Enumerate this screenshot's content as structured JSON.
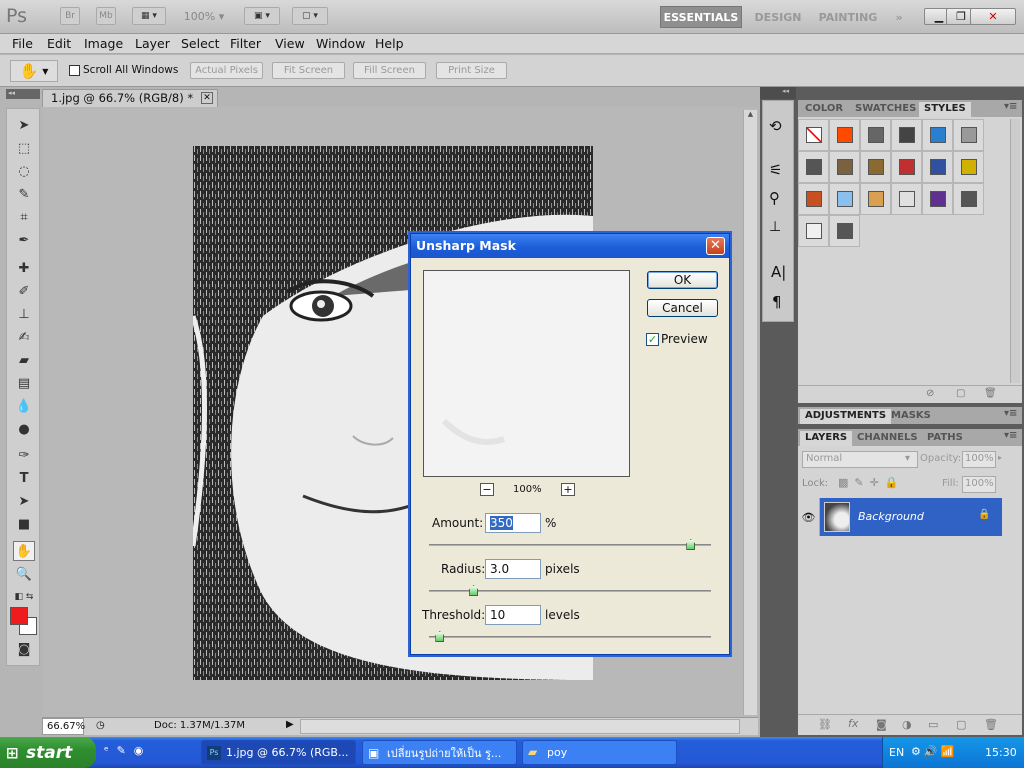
{
  "app": {
    "logo": "Ps",
    "bridge": "Br",
    "minibridge": "Mb",
    "zoom": "100%"
  },
  "workspaces": [
    "ESSENTIALS",
    "DESIGN",
    "PAINTING"
  ],
  "menu": [
    "File",
    "Edit",
    "Image",
    "Layer",
    "Select",
    "Filter",
    "View",
    "Window",
    "Help"
  ],
  "options": {
    "scroll_all": "Scroll All Windows",
    "buttons": [
      "Actual Pixels",
      "Fit Screen",
      "Fill Screen",
      "Print Size"
    ]
  },
  "document": {
    "tab": "1.jpg @ 66.7% (RGB/8) *",
    "zoom": "66.67%",
    "doc_info": "Doc: 1.37M/1.37M"
  },
  "panels": {
    "top_tabs": [
      "COLOR",
      "SWATCHES",
      "STYLES"
    ],
    "mid_tabs": [
      "ADJUSTMENTS",
      "MASKS"
    ],
    "layer_tabs": [
      "LAYERS",
      "CHANNELS",
      "PATHS"
    ],
    "blend_mode": "Normal",
    "opacity_label": "Opacity:",
    "opacity": "100%",
    "lock_label": "Lock:",
    "fill_label": "Fill:",
    "fill": "100%",
    "layer_name": "Background"
  },
  "styles_colors": [
    "#ffffff",
    "#ff4a00",
    "#666666",
    "#444444",
    "#2a7fd0",
    "#999999",
    "#555555",
    "#7a6240",
    "#8a6a30",
    "#c03030",
    "#3050a0",
    "#d0b000",
    "#c85020",
    "#8ac0ee",
    "#d8a050",
    "#e0e0e0",
    "#603090",
    "#555555",
    "#f0f0f0",
    "#555555"
  ],
  "dialog": {
    "title": "Unsharp Mask",
    "ok": "OK",
    "cancel": "Cancel",
    "preview_label": "Preview",
    "preview_checked": true,
    "zoom": "100%",
    "zoom_out": "−",
    "zoom_in": "+",
    "amount_label": "Amount:",
    "amount": "350",
    "amount_unit": "%",
    "amount_frac": 0.93,
    "radius_label": "Radius:",
    "radius": "3.0",
    "radius_unit": "pixels",
    "radius_frac": 0.16,
    "threshold_label": "Threshold:",
    "threshold": "10",
    "threshold_unit": "levels",
    "threshold_frac": 0.04
  },
  "taskbar": {
    "start": "start",
    "tasks": [
      "1.jpg @ 66.7% (RGB...",
      "เปลี่ยนรูปถ่ายให้เป็น รู...",
      "poy"
    ],
    "lang": "EN",
    "time": "15:30"
  }
}
